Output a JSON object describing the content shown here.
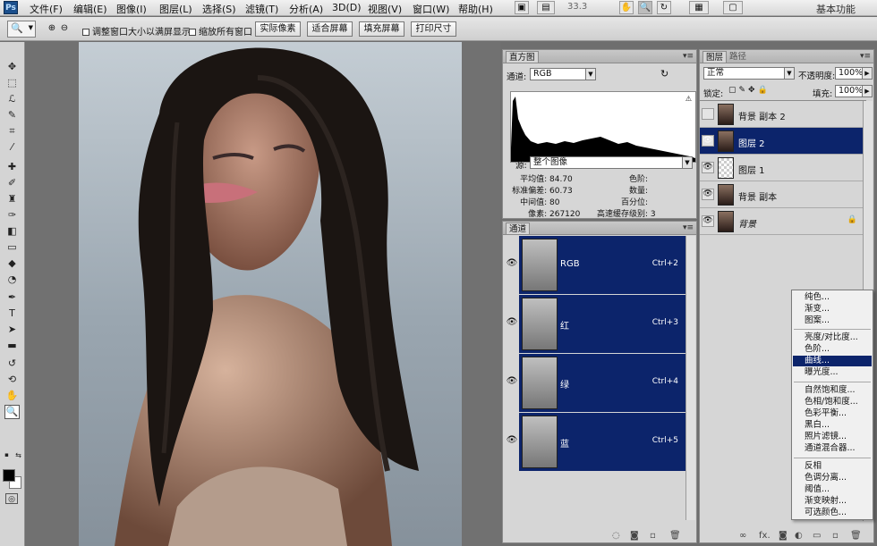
{
  "menubar": {
    "logo": "Ps",
    "items": [
      "文件(F)",
      "编辑(E)",
      "图像(I)",
      "图层(L)",
      "选择(S)",
      "滤镜(T)",
      "分析(A)",
      "3D(D)",
      "视图(V)",
      "窗口(W)",
      "帮助(H)"
    ],
    "zoom": "33.3",
    "workspace": "基本功能"
  },
  "options": {
    "check1": "调整窗口大小以满屏显示",
    "check2": "缩放所有窗口",
    "buttons": [
      "实际像素",
      "适合屏幕",
      "填充屏幕",
      "打印尺寸"
    ]
  },
  "histogram": {
    "tab": "直方图",
    "channel_label": "通道:",
    "channel_value": "RGB",
    "source_label": "源:",
    "source_value": "整个图像",
    "stats_left": [
      {
        "label": "平均值:",
        "value": "84.70"
      },
      {
        "label": "标准偏差:",
        "value": "60.73"
      },
      {
        "label": "中间值:",
        "value": "80"
      },
      {
        "label": "像素:",
        "value": "267120"
      }
    ],
    "stats_right": [
      {
        "label": "色阶:",
        "value": ""
      },
      {
        "label": "数量:",
        "value": ""
      },
      {
        "label": "百分位:",
        "value": ""
      },
      {
        "label": "高速缓存级别:",
        "value": "3"
      }
    ]
  },
  "channels": {
    "tab": "通道",
    "rows": [
      {
        "name": "RGB",
        "shortcut": "Ctrl+2"
      },
      {
        "name": "红",
        "shortcut": "Ctrl+3"
      },
      {
        "name": "绿",
        "shortcut": "Ctrl+4"
      },
      {
        "name": "蓝",
        "shortcut": "Ctrl+5"
      }
    ]
  },
  "layers": {
    "tabs": [
      "图层",
      "路径"
    ],
    "blend_mode": "正常",
    "opacity_label": "不透明度:",
    "opacity_value": "100%",
    "lock_label": "锁定:",
    "fill_label": "填充:",
    "fill_value": "100%",
    "rows": [
      {
        "name": "背景 副本 2",
        "visible": false,
        "selected": false
      },
      {
        "name": "图层 2",
        "visible": true,
        "selected": true
      },
      {
        "name": "图层 1",
        "visible": true,
        "selected": false
      },
      {
        "name": "背景 副本",
        "visible": true,
        "selected": false
      },
      {
        "name": "背景",
        "visible": true,
        "selected": false
      }
    ]
  },
  "adjust_menu": {
    "group1": [
      "纯色...",
      "渐变...",
      "图案..."
    ],
    "group2": [
      "亮度/对比度...",
      "色阶...",
      "曲线...",
      "曝光度..."
    ],
    "group3": [
      "自然饱和度...",
      "色相/饱和度...",
      "色彩平衡...",
      "黑白...",
      "照片滤镜...",
      "通道混合器..."
    ],
    "group4": [
      "反相",
      "色调分离...",
      "阈值...",
      "渐变映射...",
      "可选颜色..."
    ],
    "highlighted": "曲线..."
  },
  "colors": {
    "accent": "#0c246b",
    "panel": "#d6d6d6"
  }
}
